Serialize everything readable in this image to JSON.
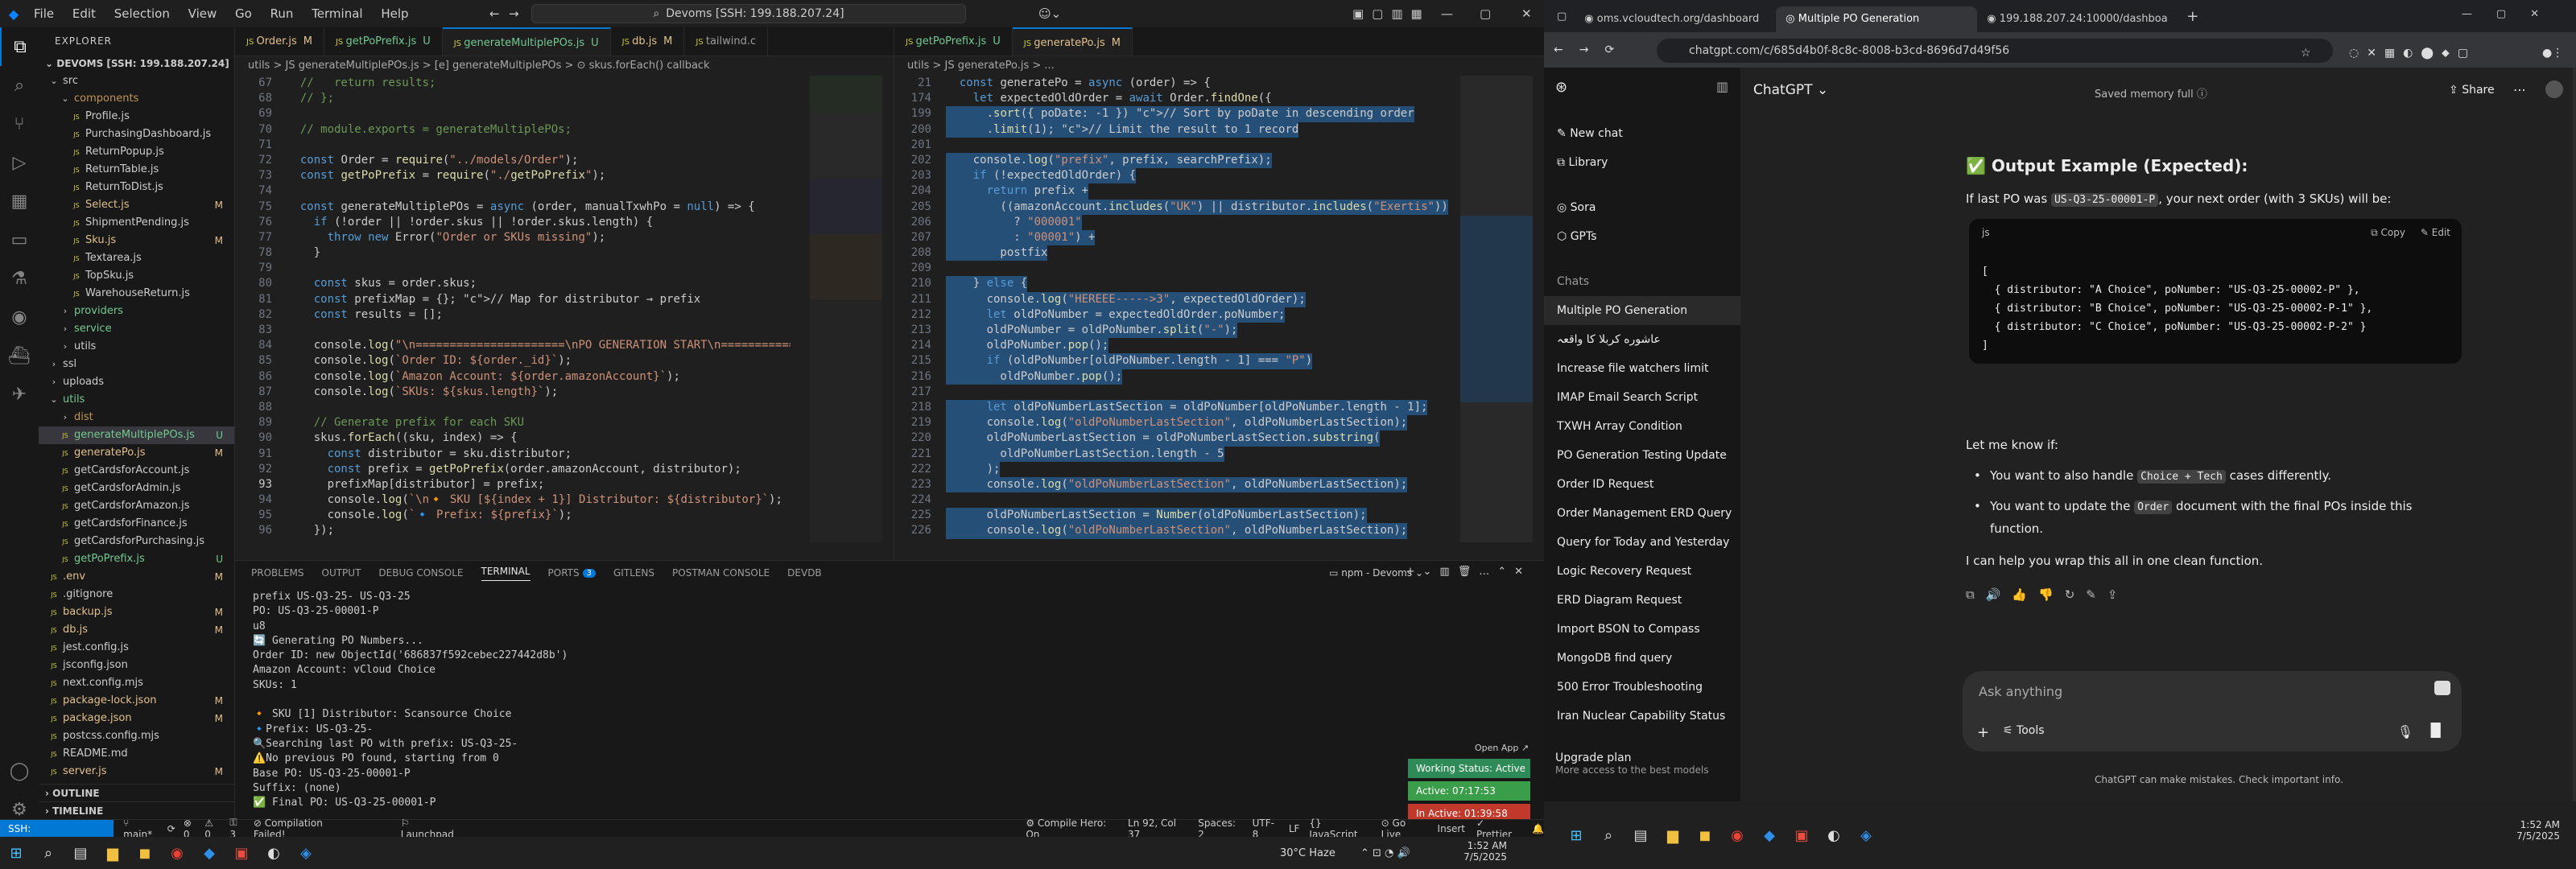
{
  "vscode": {
    "menu": [
      "File",
      "Edit",
      "Selection",
      "View",
      "Go",
      "Run",
      "Terminal",
      "Help"
    ],
    "command_center": "Devoms [SSH: 199.188.207.24]",
    "explorer_title": "EXPLORER",
    "workspace": "DEVOMS [SSH: 199.188.207.24]",
    "tree": [
      {
        "label": "src",
        "depth": 0,
        "type": "folder",
        "open": true
      },
      {
        "label": "components",
        "depth": 1,
        "type": "folder",
        "open": true,
        "color": "#c09553"
      },
      {
        "label": "Profile.js",
        "depth": 2,
        "type": "file"
      },
      {
        "label": "PurchasingDashboard.js",
        "depth": 2,
        "type": "file"
      },
      {
        "label": "ReturnPopup.js",
        "depth": 2,
        "type": "file"
      },
      {
        "label": "ReturnTable.js",
        "depth": 2,
        "type": "file"
      },
      {
        "label": "ReturnToDist.js",
        "depth": 2,
        "type": "file"
      },
      {
        "label": "Select.js",
        "depth": 2,
        "type": "file",
        "badge": "M",
        "badge_color": "#e2c08d",
        "color": "#e2c08d"
      },
      {
        "label": "ShipmentPending.js",
        "depth": 2,
        "type": "file"
      },
      {
        "label": "Sku.js",
        "depth": 2,
        "type": "file",
        "badge": "M",
        "badge_color": "#e2c08d",
        "color": "#e2c08d"
      },
      {
        "label": "Textarea.js",
        "depth": 2,
        "type": "file"
      },
      {
        "label": "TopSku.js",
        "depth": 2,
        "type": "file"
      },
      {
        "label": "WarehouseReturn.js",
        "depth": 2,
        "type": "file"
      },
      {
        "label": "providers",
        "depth": 1,
        "type": "folder",
        "open": false,
        "color": "#73c991"
      },
      {
        "label": "service",
        "depth": 1,
        "type": "folder",
        "open": false,
        "color": "#73c991"
      },
      {
        "label": "utils",
        "depth": 1,
        "type": "folder",
        "open": false
      },
      {
        "label": "ssl",
        "depth": 0,
        "type": "folder",
        "open": false
      },
      {
        "label": "uploads",
        "depth": 0,
        "type": "folder",
        "open": false
      },
      {
        "label": "utils",
        "depth": 0,
        "type": "folder",
        "open": true,
        "color": "#73c991"
      },
      {
        "label": "dist",
        "depth": 1,
        "type": "folder",
        "open": false,
        "color": "#c09553"
      },
      {
        "label": "generateMultiplePOs.js",
        "depth": 1,
        "type": "file",
        "badge": "U",
        "badge_color": "#73c991",
        "color": "#73c991",
        "selected": true
      },
      {
        "label": "generatePo.js",
        "depth": 1,
        "type": "file",
        "badge": "M",
        "badge_color": "#e2c08d",
        "color": "#e2c08d"
      },
      {
        "label": "getCardsforAccount.js",
        "depth": 1,
        "type": "file"
      },
      {
        "label": "getCardsforAdmin.js",
        "depth": 1,
        "type": "file"
      },
      {
        "label": "getCardsforAmazon.js",
        "depth": 1,
        "type": "file"
      },
      {
        "label": "getCardsforFinance.js",
        "depth": 1,
        "type": "file"
      },
      {
        "label": "getCardsforPurchasing.js",
        "depth": 1,
        "type": "file"
      },
      {
        "label": "getPoPrefix.js",
        "depth": 1,
        "type": "file",
        "badge": "U",
        "badge_color": "#73c991",
        "color": "#73c991"
      },
      {
        "label": ".env",
        "depth": 0,
        "type": "file",
        "badge": "M",
        "badge_color": "#e2c08d",
        "color": "#e2c08d"
      },
      {
        "label": ".gitignore",
        "depth": 0,
        "type": "file"
      },
      {
        "label": "backup.js",
        "depth": 0,
        "type": "file",
        "badge": "M",
        "badge_color": "#e2c08d",
        "color": "#e2c08d"
      },
      {
        "label": "db.js",
        "depth": 0,
        "type": "file",
        "badge": "M",
        "badge_color": "#e2c08d",
        "color": "#e2c08d"
      },
      {
        "label": "jest.config.js",
        "depth": 0,
        "type": "file"
      },
      {
        "label": "jsconfig.json",
        "depth": 0,
        "type": "file"
      },
      {
        "label": "next.config.mjs",
        "depth": 0,
        "type": "file"
      },
      {
        "label": "package-lock.json",
        "depth": 0,
        "type": "file",
        "badge": "M",
        "badge_color": "#e2c08d",
        "color": "#e2c08d"
      },
      {
        "label": "package.json",
        "depth": 0,
        "type": "file",
        "badge": "M",
        "badge_color": "#e2c08d",
        "color": "#e2c08d"
      },
      {
        "label": "postcss.config.mjs",
        "depth": 0,
        "type": "file"
      },
      {
        "label": "README.md",
        "depth": 0,
        "type": "file"
      },
      {
        "label": "server.js",
        "depth": 0,
        "type": "file",
        "badge": "M",
        "badge_color": "#e2c08d",
        "color": "#e2c08d"
      }
    ],
    "outline": "OUTLINE",
    "timeline": "TIMELINE",
    "left_tabs": [
      {
        "label": "Order.js",
        "mod": "M"
      },
      {
        "label": "getPoPrefix.js",
        "mod": "U"
      },
      {
        "label": "generateMultiplePOs.js",
        "mod": "U",
        "active": true
      },
      {
        "label": "db.js",
        "mod": "M"
      },
      {
        "label": "tailwind.c",
        "mod": ""
      }
    ],
    "right_tabs": [
      {
        "label": "getPoPrefix.js",
        "mod": "U"
      },
      {
        "label": "generatePo.js",
        "mod": "M",
        "active": true
      }
    ],
    "left_crumbs": "utils > JS generateMultiplePOs.js > [e] generateMultiplePOs > ⊙ skus.forEach() callback",
    "right_crumbs": "utils > JS generatePo.js > ...",
    "left_code": [
      {
        "n": "67",
        "t": "  //   return results;",
        "c": "c"
      },
      {
        "n": "68",
        "t": "  // };",
        "c": "c"
      },
      {
        "n": "69",
        "t": "",
        "c": ""
      },
      {
        "n": "70",
        "t": "  // module.exports = generateMultiplePOs;",
        "c": "c"
      },
      {
        "n": "71",
        "t": "",
        "c": ""
      },
      {
        "n": "72",
        "t": "  const Order = require(\"../models/Order\");",
        "c": "mix"
      },
      {
        "n": "73",
        "t": "  const getPoPrefix = require(\"./getPoPrefix\");",
        "c": "mix"
      },
      {
        "n": "74",
        "t": "",
        "c": ""
      },
      {
        "n": "75",
        "t": "  const generateMultiplePOs = async (order, manualTxwhPo = null) => {",
        "c": "mix"
      },
      {
        "n": "76",
        "t": "    if (!order || !order.skus || !order.skus.length) {",
        "c": "mix"
      },
      {
        "n": "77",
        "t": "      throw new Error(\"Order or SKUs missing\");",
        "c": "mix"
      },
      {
        "n": "78",
        "t": "    }",
        "c": ""
      },
      {
        "n": "79",
        "t": "",
        "c": ""
      },
      {
        "n": "80",
        "t": "    const skus = order.skus;",
        "c": "mix"
      },
      {
        "n": "81",
        "t": "    const prefixMap = {}; // Map for distributor → prefix",
        "c": "mix"
      },
      {
        "n": "82",
        "t": "    const results = [];",
        "c": "mix"
      },
      {
        "n": "83",
        "t": "",
        "c": ""
      },
      {
        "n": "84",
        "t": "    console.log(\"\\n======================\\nPO GENERATION START\\n======================\");",
        "c": "mix"
      },
      {
        "n": "85",
        "t": "    console.log(`Order ID: ${order._id}`);",
        "c": "mix"
      },
      {
        "n": "86",
        "t": "    console.log(`Amazon Account: ${order.amazonAccount}`);",
        "c": "mix"
      },
      {
        "n": "87",
        "t": "    console.log(`SKUs: ${skus.length}`);",
        "c": "mix"
      },
      {
        "n": "88",
        "t": "",
        "c": ""
      },
      {
        "n": "89",
        "t": "    // Generate prefix for each SKU",
        "c": "c"
      },
      {
        "n": "90",
        "t": "    skus.forEach((sku, index) => {",
        "c": "mix"
      },
      {
        "n": "91",
        "t": "      const distributor = sku.distributor;",
        "c": "mix"
      },
      {
        "n": "92",
        "t": "      const prefix = getPoPrefix(order.amazonAccount, distributor);",
        "c": "mix"
      },
      {
        "n": "93",
        "t": "      prefixMap[distributor] = prefix;",
        "c": "mix",
        "cur": true
      },
      {
        "n": "94",
        "t": "      console.log(`\\n🔸 SKU [${index + 1}] Distributor: ${distributor}`);",
        "c": "mix"
      },
      {
        "n": "95",
        "t": "      console.log(`🔹 Prefix: ${prefix}`);",
        "c": "mix"
      },
      {
        "n": "96",
        "t": "    });",
        "c": ""
      }
    ],
    "right_code": [
      {
        "n": "21",
        "t": "  const generatePo = async (order) => {",
        "c": "mix"
      },
      {
        "n": "174",
        "t": "    let expectedOldOrder = await Order.findOne({",
        "c": "mix"
      },
      {
        "n": "199",
        "t": "      .sort({ poDate: -1 }) // Sort by poDate in descending order",
        "c": "hl"
      },
      {
        "n": "200",
        "t": "      .limit(1); // Limit the result to 1 record",
        "c": "hl"
      },
      {
        "n": "201",
        "t": "",
        "c": "hl"
      },
      {
        "n": "202",
        "t": "    console.log(\"prefix\", prefix, searchPrefix);",
        "c": "hl"
      },
      {
        "n": "203",
        "t": "    if (!expectedOldOrder) {",
        "c": "hl"
      },
      {
        "n": "204",
        "t": "      return prefix +",
        "c": "hl"
      },
      {
        "n": "205",
        "t": "        ((amazonAccount.includes(\"UK\") || distributor.includes(\"Exertis\"))",
        "c": "hl"
      },
      {
        "n": "206",
        "t": "          ? \"000001\"",
        "c": "hl"
      },
      {
        "n": "207",
        "t": "          : \"00001\") +",
        "c": "hl"
      },
      {
        "n": "208",
        "t": "        postfix",
        "c": "hl"
      },
      {
        "n": "209",
        "t": "",
        "c": "hl"
      },
      {
        "n": "210",
        "t": "    } else {",
        "c": "hl"
      },
      {
        "n": "211",
        "t": "      console.log(\"HEREEE----->3\", expectedOldOrder);",
        "c": "hl"
      },
      {
        "n": "212",
        "t": "      let oldPoNumber = expectedOldOrder.poNumber;",
        "c": "hl"
      },
      {
        "n": "213",
        "t": "      oldPoNumber = oldPoNumber.split(\"-\");",
        "c": "hl"
      },
      {
        "n": "214",
        "t": "      oldPoNumber.pop();",
        "c": "hl"
      },
      {
        "n": "215",
        "t": "      if (oldPoNumber[oldPoNumber.length - 1] === \"P\")",
        "c": "hl"
      },
      {
        "n": "216",
        "t": "        oldPoNumber.pop();",
        "c": "hl"
      },
      {
        "n": "217",
        "t": "",
        "c": "hl"
      },
      {
        "n": "218",
        "t": "      let oldPoNumberLastSection = oldPoNumber[oldPoNumber.length - 1];",
        "c": "hl"
      },
      {
        "n": "219",
        "t": "      console.log(\"oldPoNumberLastSection\", oldPoNumberLastSection);",
        "c": "hl"
      },
      {
        "n": "220",
        "t": "      oldPoNumberLastSection = oldPoNumberLastSection.substring(",
        "c": "hl"
      },
      {
        "n": "221",
        "t": "        oldPoNumberLastSection.length - 5",
        "c": "hl"
      },
      {
        "n": "222",
        "t": "      );",
        "c": "hl"
      },
      {
        "n": "223",
        "t": "      console.log(\"oldPoNumberLastSection\", oldPoNumberLastSection);",
        "c": "hl"
      },
      {
        "n": "224",
        "t": "",
        "c": "hl"
      },
      {
        "n": "225",
        "t": "      oldPoNumberLastSection = Number(oldPoNumberLastSection);",
        "c": "hl"
      },
      {
        "n": "226",
        "t": "      console.log(\"oldPoNumberLastSection\", oldPoNumberLastSection);",
        "c": "hl"
      }
    ],
    "panel_tabs": [
      "PROBLEMS",
      "OUTPUT",
      "DEBUG CONSOLE",
      "TERMINAL",
      "PORTS",
      "GITLENS",
      "POSTMAN CONSOLE",
      "DEVDB"
    ],
    "ports_badge": "3",
    "terminal_name": "npm - Devoms",
    "terminal": [
      "prefix US-Q3-25- US-Q3-25",
      "PO: US-Q3-25-00001-P",
      "u8",
      "🔄 Generating PO Numbers...",
      "Order ID: new ObjectId('686837f592cebec227442d8b')",
      "Amazon Account: vCloud Choice",
      "SKUs: 1",
      "",
      "🔸 SKU [1] Distributor: Scansource Choice",
      "🔹Prefix: US-Q3-25-",
      "🔍Searching last PO with prefix: US-Q3-25-",
      "⚠️No previous PO found, starting from 0",
      "Base PO: US-Q3-25-00001-P",
      "Suffix: (none)",
      "✅ Final PO: US-Q3-25-00001-P"
    ],
    "open_app": "Open App ↗",
    "working_status": "Working Status: Active",
    "active_time": "Active: 07:17:53",
    "inactive_time": "In Active: 01:39:58",
    "status": {
      "remote": "SSH: 199.188.207.24",
      "branch": "main*",
      "sync": "⟳",
      "errors": "⊗ 0",
      "warnings": "⚠ 0",
      "ports": "⚿ 3",
      "compilation": "Compilation Failed!",
      "launchpad": "Launchpad",
      "compile_hero": "Compile Hero: On",
      "position": "Ln 92, Col 37",
      "spaces": "Spaces: 2",
      "encoding": "UTF-8",
      "eol": "LF",
      "language": "{} JavaScript",
      "golive": "Go Live",
      "insert": "Insert",
      "prettier": "Prettier"
    },
    "weather": "30°C  Haze",
    "clock_time": "1:52 AM",
    "clock_date": "7/5/2025"
  },
  "chrome": {
    "tabs": [
      {
        "label": "oms.vcloudtech.org/dashboard"
      },
      {
        "label": "Multiple PO Generation",
        "active": true
      },
      {
        "label": "199.188.207.24:10000/dashboa"
      }
    ],
    "url": "chatgpt.com/c/685d4b0f-8c8c-8008-b3cd-8696d7d49f56",
    "sidebar": {
      "new_chat": "New chat",
      "library": "Library",
      "sora": "Sora",
      "gpts": "GPTs",
      "chats_heading": "Chats",
      "chats": [
        "Multiple PO Generation",
        "عاشوره کربلا کا واقعہ",
        "Increase file watchers limit",
        "IMAP Email Search Script",
        "TXWH Array Condition",
        "PO Generation Testing Update",
        "Order ID Request",
        "Order Management ERD Query",
        "Query for Today and Yesterday",
        "Logic Recovery Request",
        "ERD Diagram Request",
        "Import BSON to Compass",
        "MongoDB find query",
        "500 Error Troubleshooting",
        "Iran Nuclear Capability Status"
      ],
      "upgrade": "Upgrade plan",
      "upgrade_sub": "More access to the best models"
    },
    "main": {
      "model": "ChatGPT ⌄",
      "memory": "Saved memory full ⓘ",
      "share": "Share",
      "heading": "✅ Output Example (Expected):",
      "intro_prefix": "If last PO was ",
      "intro_code": "US-Q3-25-00001-P",
      "intro_suffix": ", your next order (with 3 SKUs) will be:",
      "code_lang": "js",
      "copy": "Copy",
      "edit": "Edit",
      "code_lines": [
        "[",
        "  { distributor: \"A Choice\", poNumber: \"US-Q3-25-00002-P\" },",
        "  { distributor: \"B Choice\", poNumber: \"US-Q3-25-00002-P-1\" },",
        "  { distributor: \"C Choice\", poNumber: \"US-Q3-25-00002-P-2\" }",
        "]"
      ],
      "let_me_know": "Let me know if:",
      "bullet1_a": "You want to also handle ",
      "bullet1_code": "Choice + Tech",
      "bullet1_b": " cases differently.",
      "bullet2_a": "You want to update the ",
      "bullet2_code": "Order",
      "bullet2_b": " document with the final POs inside this function.",
      "closing": "I can help you wrap this all in one clean function.",
      "ask": "Ask anything",
      "tools": "Tools",
      "disclaimer": "ChatGPT can make mistakes. Check important info."
    },
    "clock_time": "1:52 AM",
    "clock_date": "7/5/2025"
  }
}
